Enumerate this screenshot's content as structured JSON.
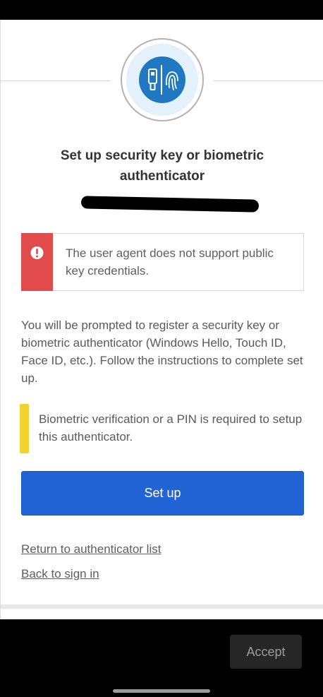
{
  "status_bar": {
    "left_text": "",
    "right_text": ""
  },
  "logo": {
    "icon": "security-key-fingerprint-icon",
    "colors": {
      "ring": "#b3b3b3",
      "halo": "#e3f1fb",
      "core": "#1f78c1"
    }
  },
  "main": {
    "title": "Set up security key or biometric authenticator",
    "user_identifier": "(redacted)",
    "error": {
      "icon": "exclamation-circle-icon",
      "message": "The user agent does not support public key credentials.",
      "color": "#e14b4b"
    },
    "instructions": "You will be prompted to register a security key or biometric authenticator (Windows Hello, Touch ID, Face ID, etc.). Follow the instructions to complete set up.",
    "notice": {
      "message": "Biometric verification or a PIN is required to setup this authenticator.",
      "color": "#f2d230"
    },
    "setup_button_label": "Set up",
    "links": {
      "return_label": "Return to authenticator list",
      "back_label": "Back to sign in"
    }
  },
  "bottom_bar": {
    "accept_label": "Accept"
  },
  "colors": {
    "primary": "#2264d6",
    "text": "#5a5a5a",
    "title": "#333333"
  }
}
